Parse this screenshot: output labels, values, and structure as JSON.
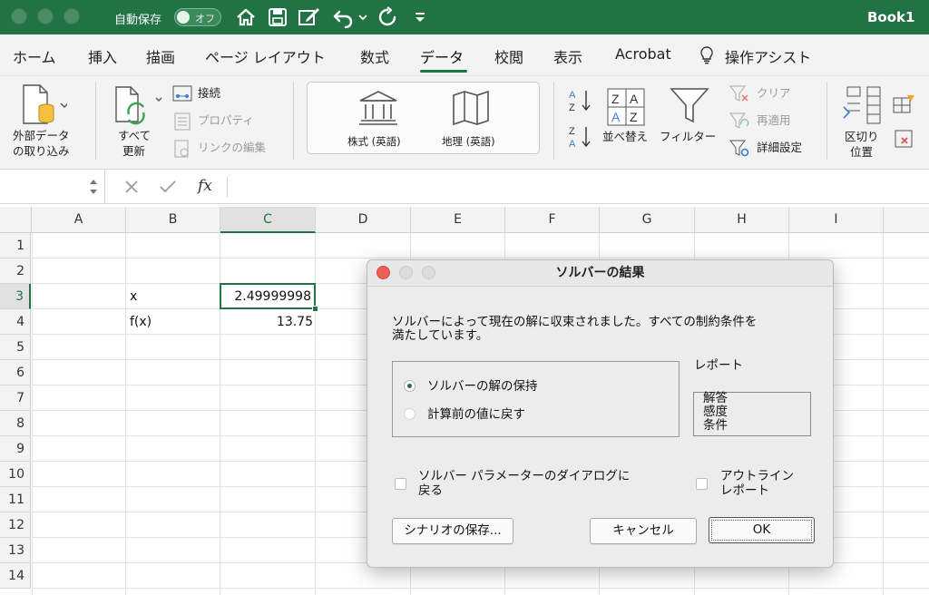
{
  "titlebar": {
    "autosave_label": "自動保存",
    "autosave_state": "オフ",
    "app_title": "Book1"
  },
  "tabs": [
    "ホーム",
    "挿入",
    "描画",
    "ページ レイアウト",
    "数式",
    "データ",
    "校閲",
    "表示",
    "Acrobat",
    "操作アシスト"
  ],
  "active_tab": "データ",
  "ribbon": {
    "external_data": [
      "外部データ",
      "の取り込み"
    ],
    "refresh_all": [
      "すべて",
      "更新"
    ],
    "connections": "接続",
    "properties": "プロパティ",
    "edit_links": "リンクの編集",
    "stocks": "株式 (英語)",
    "geography": "地理 (英語)",
    "sort": "並べ替え",
    "filter": "フィルター",
    "clear": "クリア",
    "reapply": "再適用",
    "advanced": "詳細設定",
    "text_to_columns": [
      "区切り",
      "位置"
    ]
  },
  "formula_bar": {
    "fx_label": "fx"
  },
  "grid": {
    "columns": [
      "A",
      "B",
      "C",
      "D",
      "E",
      "F",
      "G",
      "H",
      "I"
    ],
    "rows": [
      "1",
      "2",
      "3",
      "4",
      "5",
      "6",
      "7",
      "8",
      "9",
      "10",
      "11",
      "12",
      "13",
      "14"
    ],
    "selected_column": "C",
    "selected_row": "3",
    "cells": {
      "b3": "x",
      "c3": "2.49999998",
      "b4": "f(x)",
      "c4": "13.75"
    }
  },
  "dialog": {
    "title": "ソルバーの結果",
    "message_line1": "ソルバーによって現在の解に収束されました。すべての制約条件を",
    "message_line2": "満たしています。",
    "option_keep": "ソルバーの解の保持",
    "option_restore": "計算前の値に戻す",
    "reports_label": "レポート",
    "reports": [
      "解答",
      "感度",
      "条件"
    ],
    "return_dialog_line1": "ソルバー パラメーターのダイアログに",
    "return_dialog_line2": "戻る",
    "outline_line1": "アウトライン",
    "outline_line2": "レポート",
    "save_scenario": "シナリオの保存...",
    "cancel": "キャンセル",
    "ok": "OK"
  },
  "colors": {
    "excel_green": "#217346",
    "close_red": "#ec5f57"
  }
}
